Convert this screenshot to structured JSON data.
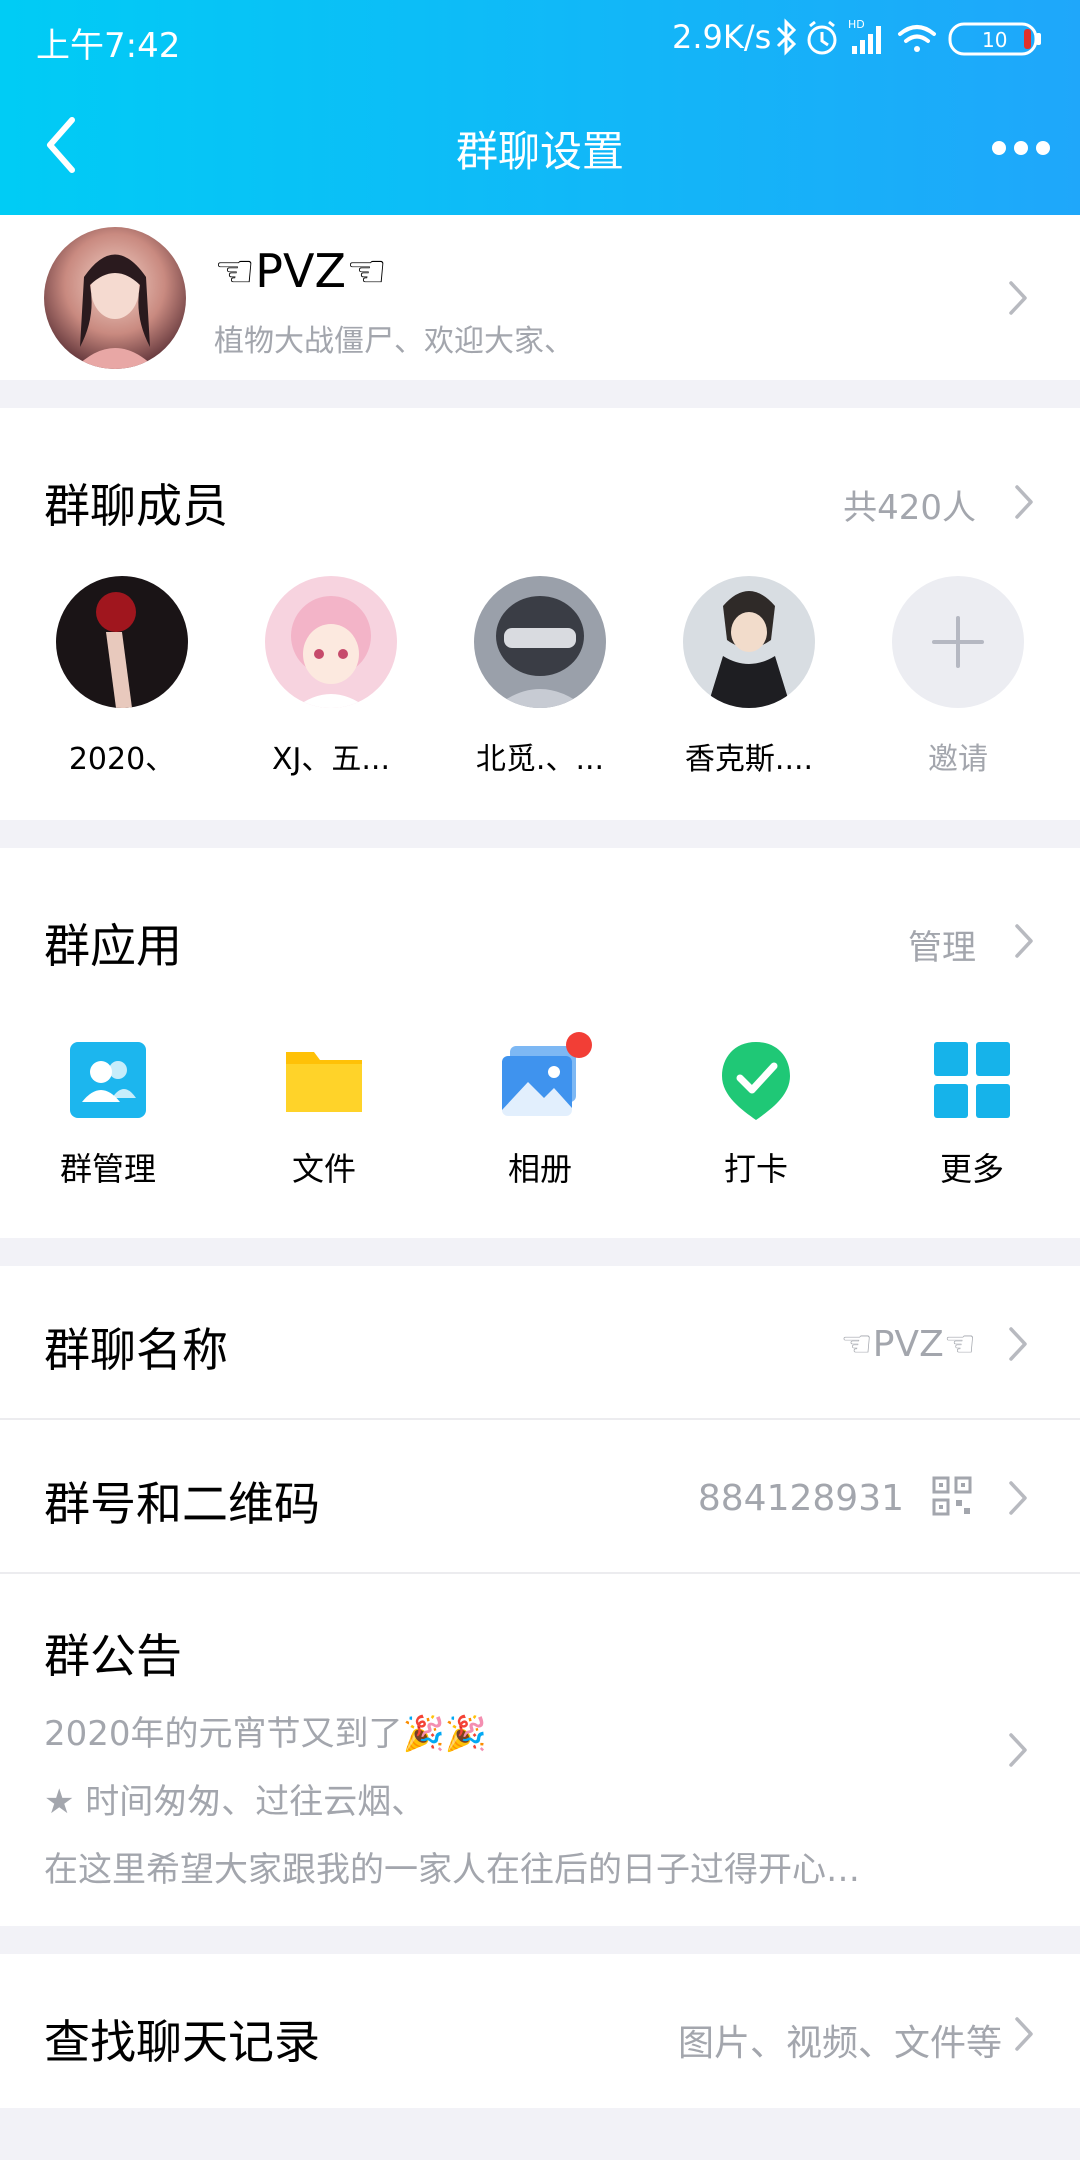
{
  "status_bar": {
    "time": "上午7:42",
    "net_speed": "2.9K/s",
    "battery": "10",
    "icons": [
      "bluetooth-icon",
      "alarm-icon",
      "signal-hd-icon",
      "wifi-icon",
      "battery-icon"
    ]
  },
  "nav": {
    "title": "群聊设置"
  },
  "group": {
    "name": "☜PVZ☜",
    "description": "植物大战僵尸、欢迎大家、"
  },
  "members": {
    "title": "群聊成员",
    "count": "共420人",
    "items": [
      {
        "name": "2020、"
      },
      {
        "name": "XJ、五..."
      },
      {
        "name": "北觅.、..."
      },
      {
        "name": "香克斯...."
      }
    ],
    "invite_label": "邀请"
  },
  "apps": {
    "title": "群应用",
    "manage": "管理",
    "items": [
      {
        "label": "群管理",
        "icon": "group-manage-icon"
      },
      {
        "label": "文件",
        "icon": "folder-icon"
      },
      {
        "label": "相册",
        "icon": "album-icon"
      },
      {
        "label": "打卡",
        "icon": "checkin-icon"
      },
      {
        "label": "更多",
        "icon": "more-apps-icon"
      }
    ]
  },
  "settings": {
    "group_name_label": "群聊名称",
    "group_name_value": "☜PVZ☜",
    "group_number_label": "群号和二维码",
    "group_number_value": "884128931",
    "notice_label": "群公告",
    "notice_lines": [
      "2020年的元宵节又到了🎉🎉",
      "★ 时间匆匆、过往云烟、",
      "在这里希望大家跟我的一家人在往后的日子过得开心…"
    ],
    "search_label": "查找聊天记录",
    "search_value": "图片、视频、文件等"
  },
  "colors": {
    "header_start": "#00CCF5",
    "header_end": "#1FA7FA",
    "secondary_text": "#A3A6AD",
    "background": "#F2F2F7"
  }
}
